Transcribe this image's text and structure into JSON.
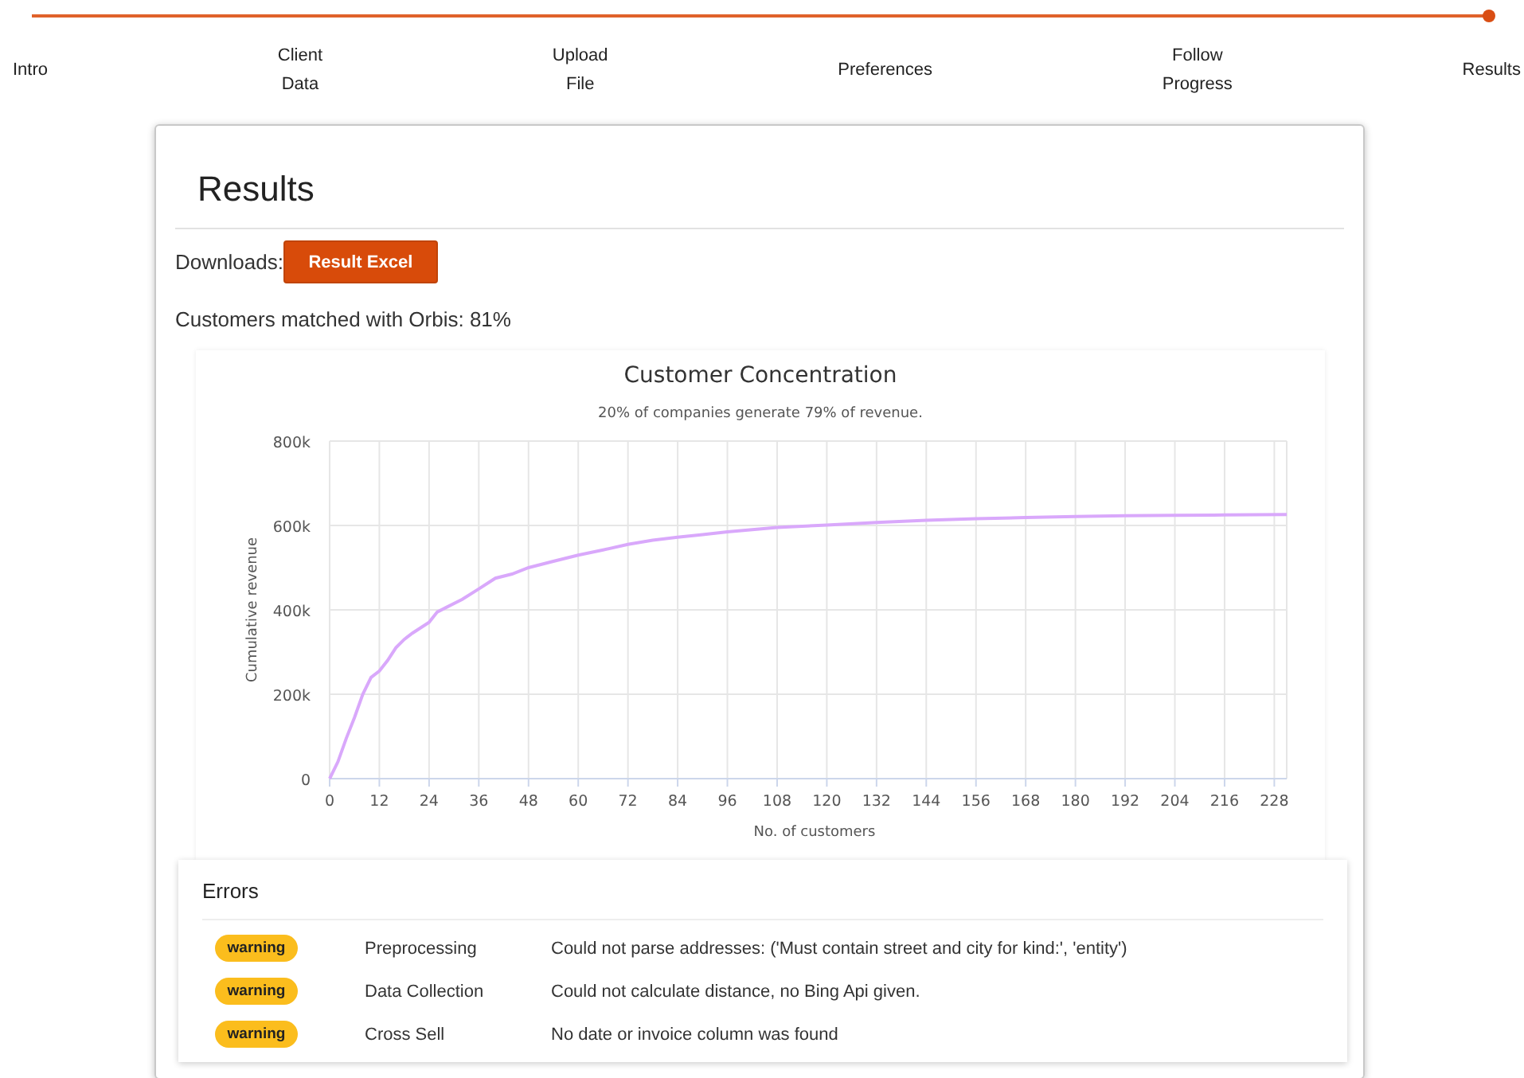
{
  "progress": {
    "level": 1
  },
  "steps": [
    {
      "label": "Intro"
    },
    {
      "label": "Client\nData"
    },
    {
      "label": "Upload\nFile"
    },
    {
      "label": "Preferences"
    },
    {
      "label": "Follow\nProgress"
    },
    {
      "label": "Results"
    }
  ],
  "results": {
    "title": "Results",
    "downloads_label": "Downloads:",
    "download_button": "Result Excel",
    "match_text": "Customers matched with Orbis: 81%",
    "chart_data": {
      "type": "line",
      "title": "Customer Concentration",
      "subtitle": "20% of companies generate 79% of revenue.",
      "xlabel": "No. of customers",
      "ylabel": "Cumulative revenue",
      "x": [
        0,
        2,
        4,
        6,
        8,
        10,
        12,
        14,
        16,
        18,
        20,
        24,
        26,
        28,
        32,
        36,
        40,
        44,
        48,
        54,
        60,
        66,
        72,
        78,
        84,
        90,
        96,
        102,
        108,
        120,
        132,
        144,
        156,
        168,
        180,
        192,
        204,
        216,
        231
      ],
      "grid": true,
      "series": [
        {
          "color": "#d9a8fb",
          "values": [
            0,
            40000,
            95000,
            145000,
            200000,
            240000,
            255000,
            280000,
            310000,
            330000,
            345000,
            370000,
            395000,
            405000,
            425000,
            450000,
            475000,
            485000,
            500000,
            515000,
            530000,
            542000,
            555000,
            565000,
            572000,
            578000,
            585000,
            590000,
            595000,
            601000,
            607000,
            612000,
            616000,
            619000,
            621000,
            623000,
            624000,
            625000,
            626000
          ]
        }
      ],
      "xlim": [
        0,
        231
      ],
      "ylim": [
        0,
        800000
      ],
      "xticks": [
        0,
        12,
        24,
        36,
        48,
        60,
        72,
        84,
        96,
        108,
        120,
        132,
        144,
        156,
        168,
        180,
        192,
        204,
        216,
        228
      ],
      "yticks": [
        {
          "value": 0,
          "label": "0"
        },
        {
          "value": 200000,
          "label": "200k"
        },
        {
          "value": 400000,
          "label": "400k"
        },
        {
          "value": 600000,
          "label": "600k"
        },
        {
          "value": 800000,
          "label": "800k"
        }
      ]
    }
  },
  "errors": {
    "title": "Errors",
    "rows": [
      {
        "level": "warning",
        "stage": "Preprocessing",
        "message": "Could not parse addresses: ('Must contain street and city for kind:', 'entity')"
      },
      {
        "level": "warning",
        "stage": "Data Collection",
        "message": "Could not calculate distance, no Bing Api given."
      },
      {
        "level": "warning",
        "stage": "Cross Sell",
        "message": "No date or invoice column was found"
      }
    ]
  }
}
